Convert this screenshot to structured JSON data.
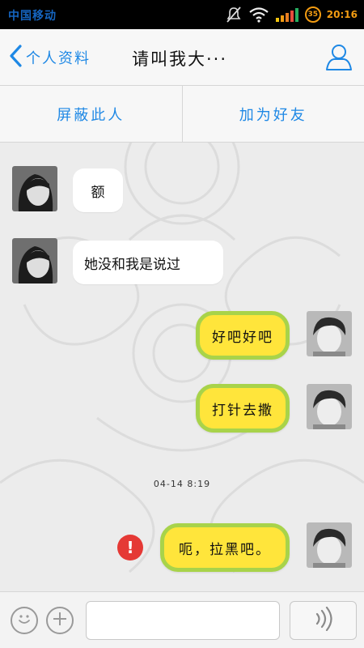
{
  "status_bar": {
    "carrier": "中国移动",
    "badge": "35",
    "time": "20:16",
    "icons": [
      "mute-icon",
      "wifi-icon",
      "signal-icon"
    ]
  },
  "nav": {
    "back_label": "个人资料",
    "title": "请叫我大···",
    "back_icon": "chevron-left-icon",
    "profile_icon": "person-icon"
  },
  "actions": {
    "block_label": "屏蔽此人",
    "add_friend_label": "加为好友"
  },
  "messages": [
    {
      "side": "left",
      "text": "额"
    },
    {
      "side": "left",
      "text": "她没和我是说过"
    },
    {
      "side": "right",
      "text": "好吧好吧"
    },
    {
      "side": "right",
      "text": "打针去撒"
    },
    {
      "type": "timestamp",
      "text": "04-14 8:19"
    },
    {
      "side": "right",
      "text": "呃，拉黑吧。",
      "status": "failed"
    }
  ],
  "input": {
    "emoji_icon": "emoji-icon",
    "plus_icon": "plus-icon",
    "voice_icon": "voice-icon",
    "value": ""
  },
  "colors": {
    "accent": "#1e88e5",
    "bubble_right_fill": "#ffe53b",
    "bubble_right_border": "#a8d34a",
    "error": "#e53935"
  }
}
